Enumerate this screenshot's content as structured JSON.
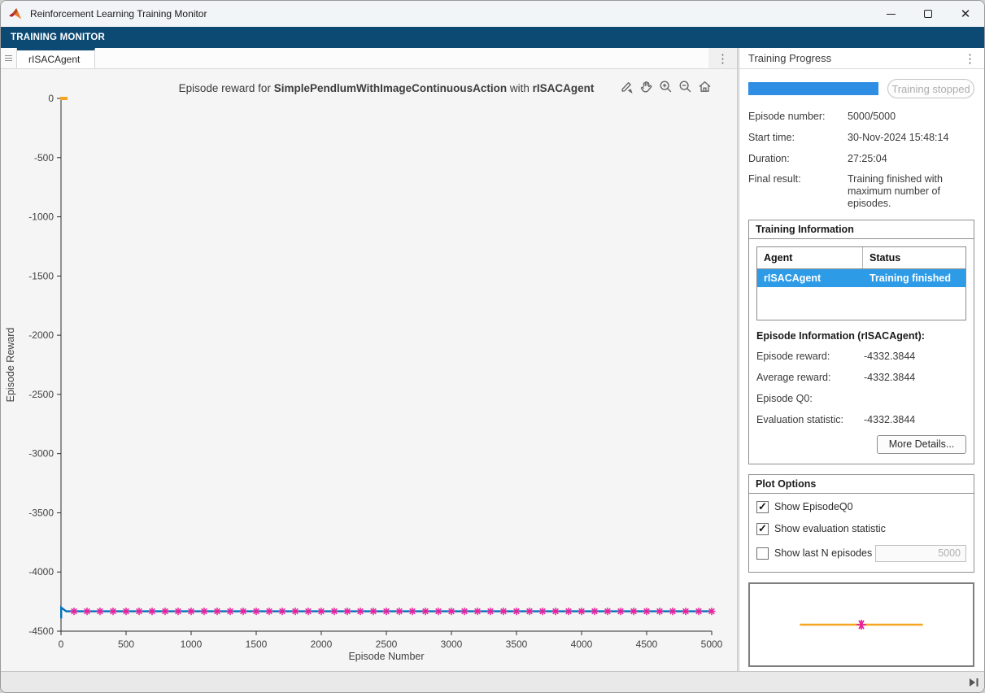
{
  "window": {
    "title": "Reinforcement Learning Training Monitor"
  },
  "toolstrip": {
    "tab_label": "TRAINING MONITOR"
  },
  "doc_tab": {
    "label": "rISACAgent"
  },
  "colors": {
    "toolstrip_navy": "#0d4a73",
    "progress_blue": "#2d8ee3",
    "selection_blue": "#2d9be6",
    "line_blue": "#0072bd",
    "marker_magenta": "#e8219e",
    "q0_orange": "#f5a623"
  },
  "chart": {
    "title_parts": {
      "prefix": "Episode reward for ",
      "env": "SimplePendlumWithImageContinuousAction",
      "mid": " with ",
      "agent": "rISACAgent"
    },
    "toolbar_icons": [
      "edit-plot",
      "pan",
      "zoom-in",
      "zoom-out",
      "home"
    ]
  },
  "chart_data": {
    "type": "line",
    "title": "Episode reward for SimplePendlumWithImageContinuousAction with rISACAgent",
    "xlabel": "Episode Number",
    "ylabel": "Episode Reward",
    "xlim": [
      0,
      5000
    ],
    "ylim": [
      -4500,
      0
    ],
    "x_ticks": [
      0,
      500,
      1000,
      1500,
      2000,
      2500,
      3000,
      3500,
      4000,
      4500,
      5000
    ],
    "y_ticks": [
      0,
      -500,
      -1000,
      -1500,
      -2000,
      -2500,
      -3000,
      -3500,
      -4000,
      -4500
    ],
    "grid": false,
    "legend_position": "none",
    "series": [
      {
        "name": "Episode reward",
        "style": "line",
        "color": "#0072bd",
        "points": [
          [
            1,
            -4392
          ],
          [
            1,
            -4300
          ],
          [
            40,
            -4332.3844
          ],
          [
            5000,
            -4332.3844
          ]
        ]
      },
      {
        "name": "Evaluation statistic",
        "style": "asterisk",
        "color": "#e8219e",
        "marker_y": -4332.3844,
        "marker_x": [
          100,
          200,
          300,
          400,
          500,
          600,
          700,
          800,
          900,
          1000,
          1100,
          1200,
          1300,
          1400,
          1500,
          1600,
          1700,
          1800,
          1900,
          2000,
          2100,
          2200,
          2300,
          2400,
          2500,
          2600,
          2700,
          2800,
          2900,
          3000,
          3100,
          3200,
          3300,
          3400,
          3500,
          3600,
          3700,
          3800,
          3900,
          4000,
          4100,
          4200,
          4300,
          4400,
          4500,
          4600,
          4700,
          4800,
          4900,
          5000
        ]
      },
      {
        "name": "EpisodeQ0",
        "style": "point",
        "color": "#f5a623",
        "points": [
          [
            0,
            0
          ]
        ]
      }
    ]
  },
  "training_progress": {
    "header": "Training Progress",
    "progress_percent": 100,
    "stop_button_label": "Training stopped",
    "fields": [
      {
        "label": "Episode number:",
        "value": "5000/5000"
      },
      {
        "label": "Start time:",
        "value": "30-Nov-2024 15:48:14"
      },
      {
        "label": "Duration:",
        "value": "27:25:04"
      },
      {
        "label": "Final result:",
        "value": "Training finished with maximum number of episodes."
      }
    ]
  },
  "training_information": {
    "header": "Training Information",
    "table": {
      "columns": [
        "Agent",
        "Status"
      ],
      "rows": [
        {
          "agent": "rISACAgent",
          "status": "Training finished",
          "selected": true
        }
      ]
    },
    "episode_info": {
      "title": "Episode Information (rISACAgent):",
      "fields": [
        {
          "label": "Episode reward:",
          "value": "-4332.3844"
        },
        {
          "label": "Average reward:",
          "value": "-4332.3844"
        },
        {
          "label": "Episode Q0:",
          "value": ""
        },
        {
          "label": "Evaluation statistic:",
          "value": "-4332.3844"
        }
      ],
      "more_details_label": "More Details..."
    }
  },
  "plot_options": {
    "header": "Plot Options",
    "checkboxes": [
      {
        "label": "Show EpisodeQ0",
        "checked": true
      },
      {
        "label": "Show evaluation statistic",
        "checked": true
      },
      {
        "label": "Show last N episodes",
        "checked": false
      }
    ],
    "n_episodes_value": "5000"
  },
  "legend_preview": {
    "line_color": "#f5a623",
    "marker_color": "#e8219e"
  }
}
